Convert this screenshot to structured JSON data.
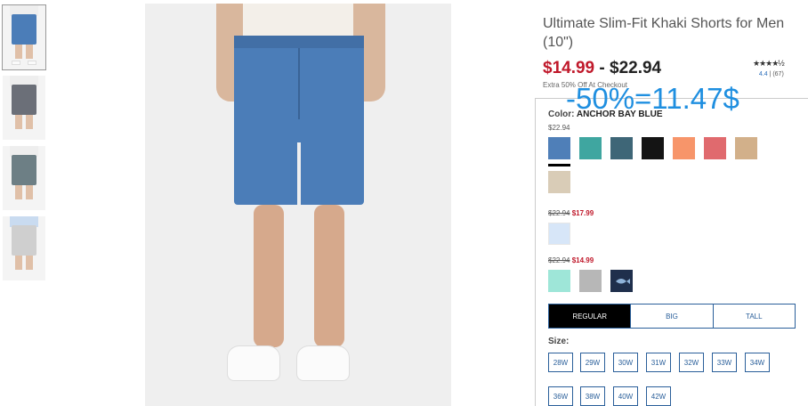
{
  "product": {
    "title": "Ultimate Slim-Fit Khaki Shorts for Men (10\")",
    "price_low": "$14.99",
    "price_sep": " - ",
    "price_high": "$22.94",
    "extra_offer": "Extra 50% Off At Checkout",
    "rating_stars": "★★★★½",
    "rating_score": "4.4",
    "rating_sep": "|",
    "rating_count": "(67)"
  },
  "overlay_note": "-50%=11.47$",
  "color": {
    "label": "Color:",
    "selected_name": "ANCHOR BAY BLUE",
    "tiers": [
      {
        "price": "$22.94"
      },
      {
        "old": "$22.94",
        "sale": "$17.99"
      },
      {
        "old": "$22.94",
        "sale": "$14.99"
      }
    ],
    "swatch_colors": {
      "tier1": [
        "#4f7fb8",
        "#3fa6a0",
        "#3e6677",
        "#141414",
        "#f7956a",
        "#e06a6e",
        "#d2b08a",
        "#d9ccb7"
      ],
      "tier2": [
        "#d7e6f8"
      ],
      "tier3": [
        "#9ee6d8",
        "#b7b7b7",
        "#1f2f4c"
      ]
    }
  },
  "fit": {
    "tabs": [
      "REGULAR",
      "BIG",
      "TALL"
    ],
    "active": "REGULAR"
  },
  "size": {
    "label": "Size:",
    "options": [
      "28W",
      "29W",
      "30W",
      "31W",
      "32W",
      "33W",
      "34W",
      "36W",
      "38W",
      "40W",
      "42W"
    ]
  },
  "colors": {
    "accent_blue": "#2a5f9a",
    "sale_red": "#c0192b",
    "overlay_blue": "#1f8fe0"
  }
}
